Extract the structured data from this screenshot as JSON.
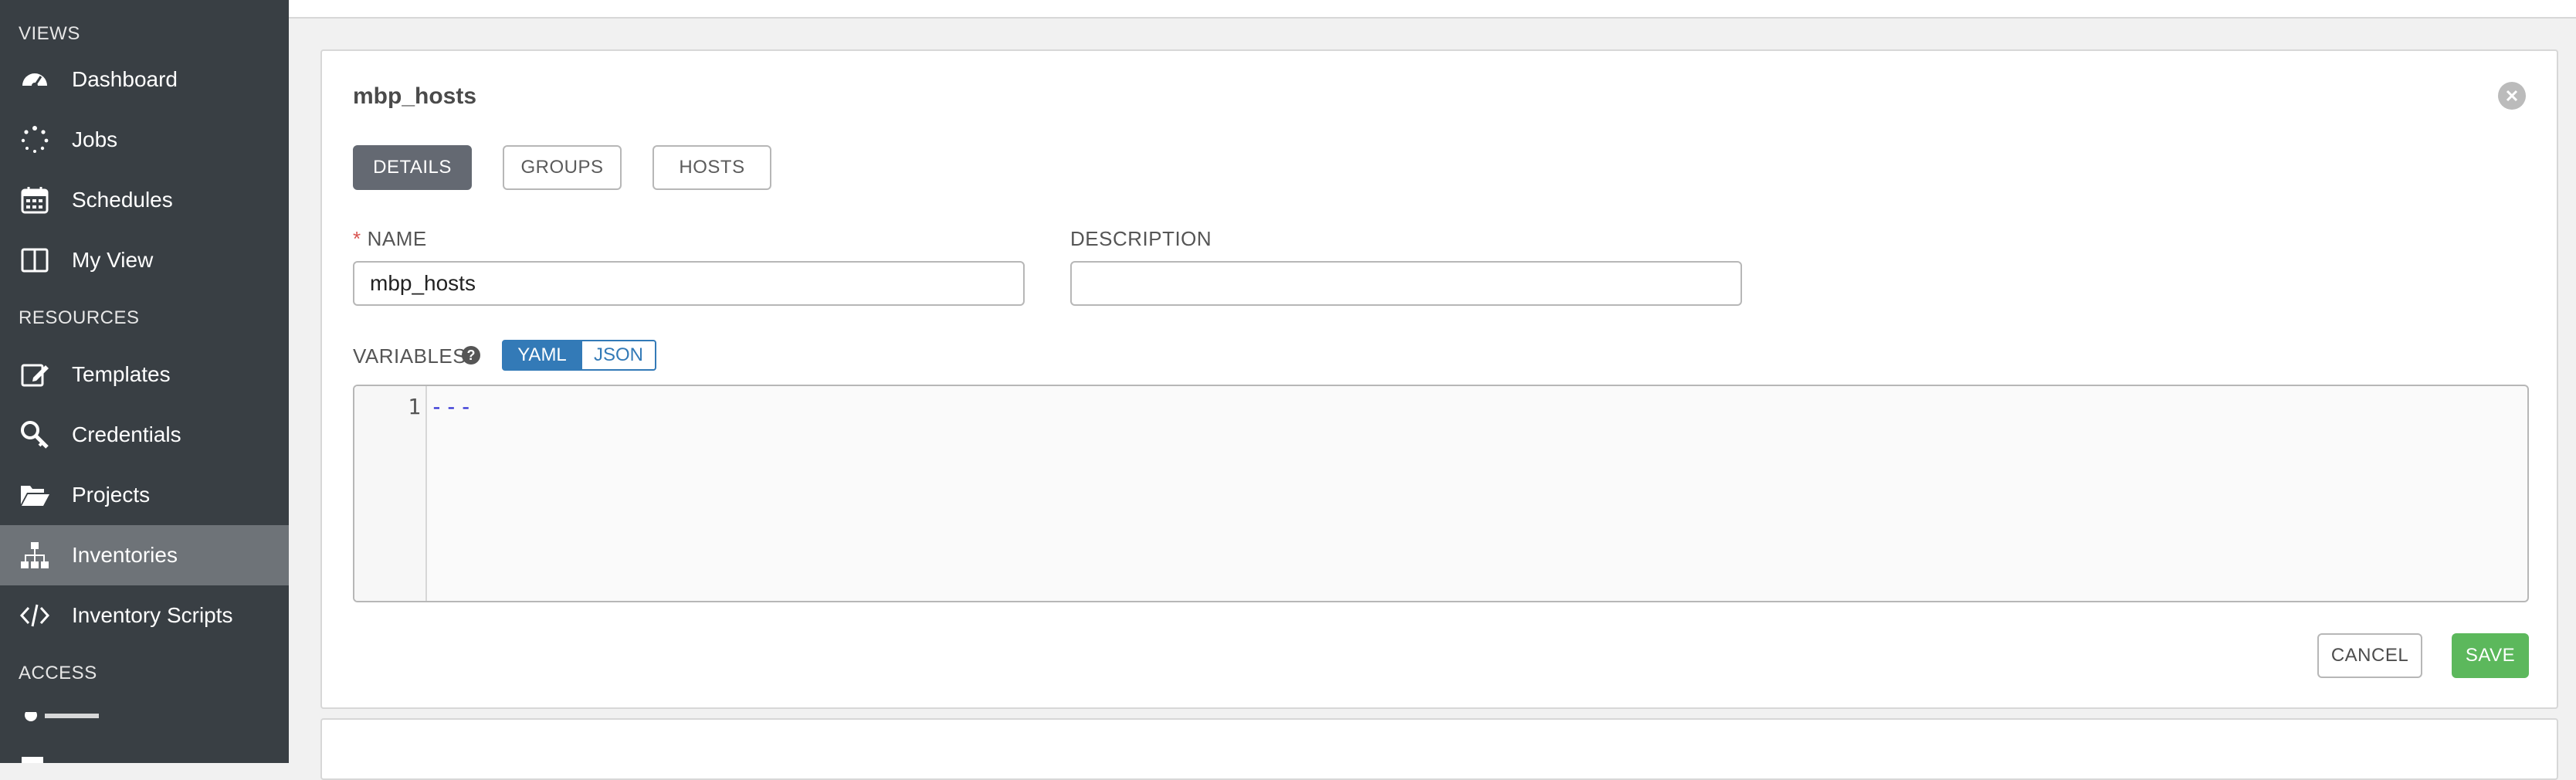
{
  "sidebar": {
    "sections": {
      "views": "VIEWS",
      "resources": "RESOURCES",
      "access": "ACCESS"
    },
    "items": [
      {
        "label": "Dashboard",
        "icon": "dashboard-icon"
      },
      {
        "label": "Jobs",
        "icon": "jobs-spinner-icon"
      },
      {
        "label": "Schedules",
        "icon": "calendar-icon"
      },
      {
        "label": "My View",
        "icon": "columns-icon"
      },
      {
        "label": "Templates",
        "icon": "edit-icon"
      },
      {
        "label": "Credentials",
        "icon": "key-icon"
      },
      {
        "label": "Projects",
        "icon": "folder-open-icon"
      },
      {
        "label": "Inventories",
        "icon": "sitemap-icon",
        "active": true
      },
      {
        "label": "Inventory Scripts",
        "icon": "code-icon"
      }
    ]
  },
  "form": {
    "title": "mbp_hosts",
    "tabs": [
      {
        "label": "DETAILS",
        "active": true
      },
      {
        "label": "GROUPS"
      },
      {
        "label": "HOSTS"
      }
    ],
    "name": {
      "label": "NAME",
      "required_mark": "*",
      "value": "mbp_hosts"
    },
    "description": {
      "label": "DESCRIPTION",
      "value": ""
    },
    "variables": {
      "label": "VARIABLES",
      "help": "?",
      "modes": [
        "YAML",
        "JSON"
      ],
      "selected_mode": "YAML",
      "line_number": "1",
      "content": "---"
    },
    "cancel_label": "CANCEL",
    "save_label": "SAVE"
  },
  "colors": {
    "sidebar_bg": "#393f44",
    "sidebar_active": "#6e7378",
    "accent_blue": "#337ab7",
    "save_green": "#5cb85c",
    "required_red": "#d9534f"
  }
}
